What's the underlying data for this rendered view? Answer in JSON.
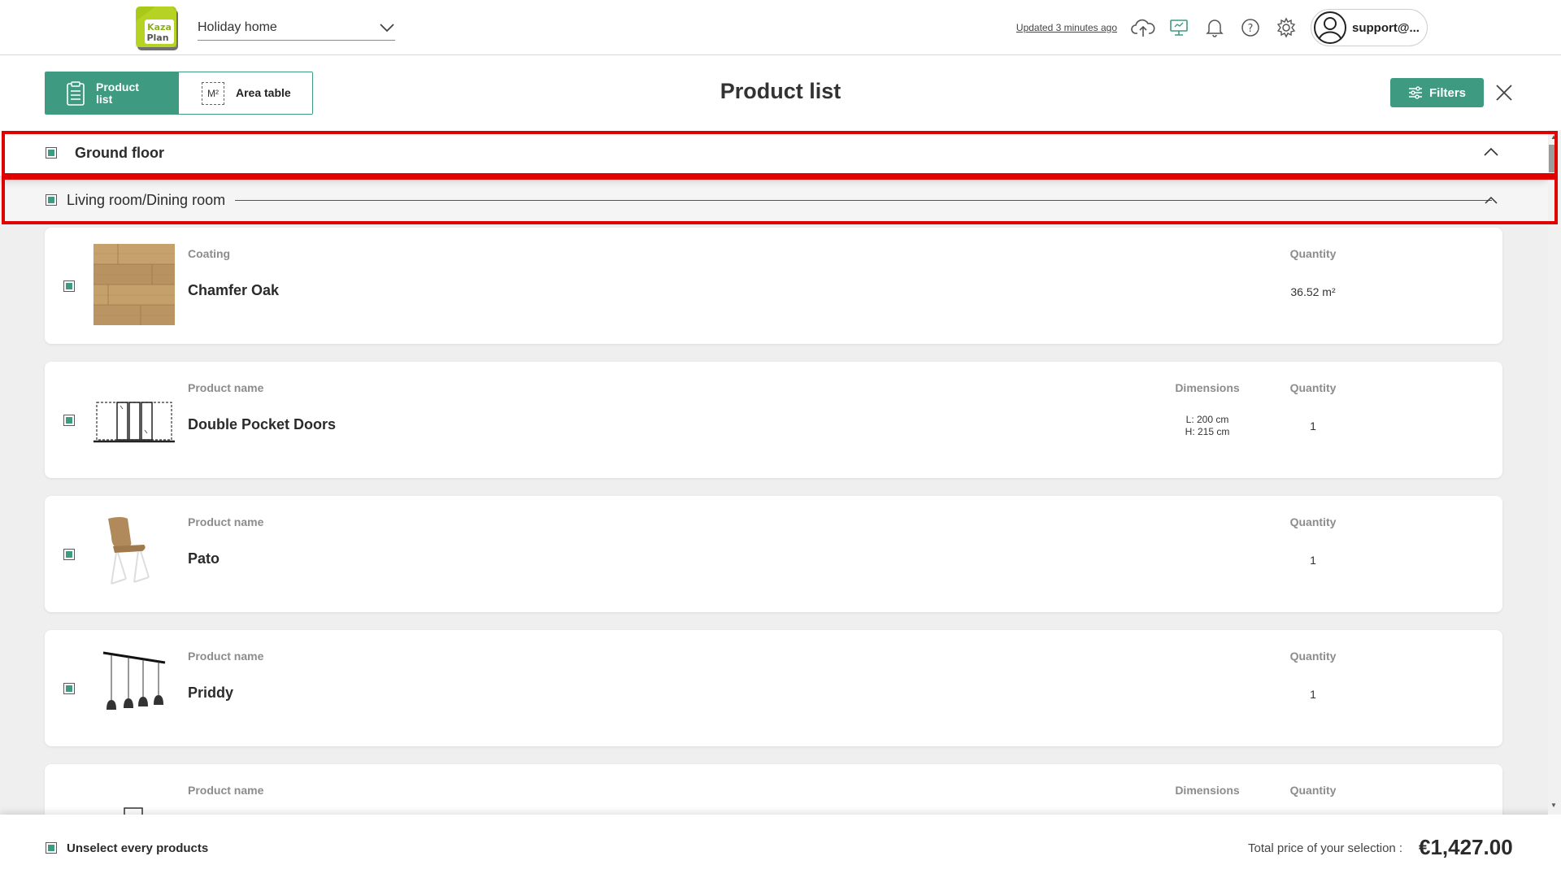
{
  "header": {
    "project_name": "Holiday home",
    "updated_text": "Updated 3 minutes ago",
    "account_name": "support@...",
    "icons": [
      "cloud-upload-icon",
      "monitor-icon",
      "bell-icon",
      "help-icon",
      "gear-icon",
      "user-avatar-icon"
    ]
  },
  "tabs": {
    "product_list": "Product list",
    "area_table": "Area table",
    "m2": "M²"
  },
  "page": {
    "title": "Product list",
    "filters_label": "Filters"
  },
  "groups": {
    "floor": "Ground floor",
    "room": "Living room/Dining room"
  },
  "labels": {
    "coating": "Coating",
    "product_name": "Product name",
    "dimensions": "Dimensions",
    "quantity": "Quantity"
  },
  "products": [
    {
      "type_label": "Coating",
      "name": "Chamfer Oak",
      "quantity": "36.52 m²",
      "thumb": "oak-texture"
    },
    {
      "type_label": "Product name",
      "name": "Double Pocket Doors",
      "dims_l": "L: 200 cm",
      "dims_h": "H: 215 cm",
      "quantity": "1",
      "thumb": "pocket-doors"
    },
    {
      "type_label": "Product name",
      "name": "Pato",
      "quantity": "1",
      "thumb": "chair"
    },
    {
      "type_label": "Product name",
      "name": "Priddy",
      "quantity": "1",
      "thumb": "pendant-lamp"
    },
    {
      "type_label": "Product name",
      "name": "",
      "quantity": "",
      "thumb": "partial"
    }
  ],
  "footer": {
    "unselect_label": "Unselect every products",
    "total_label": "Total price of your selection :",
    "total_value": "€1,427.00"
  },
  "colors": {
    "accent": "#3e9a80",
    "highlight": "#e00000"
  }
}
